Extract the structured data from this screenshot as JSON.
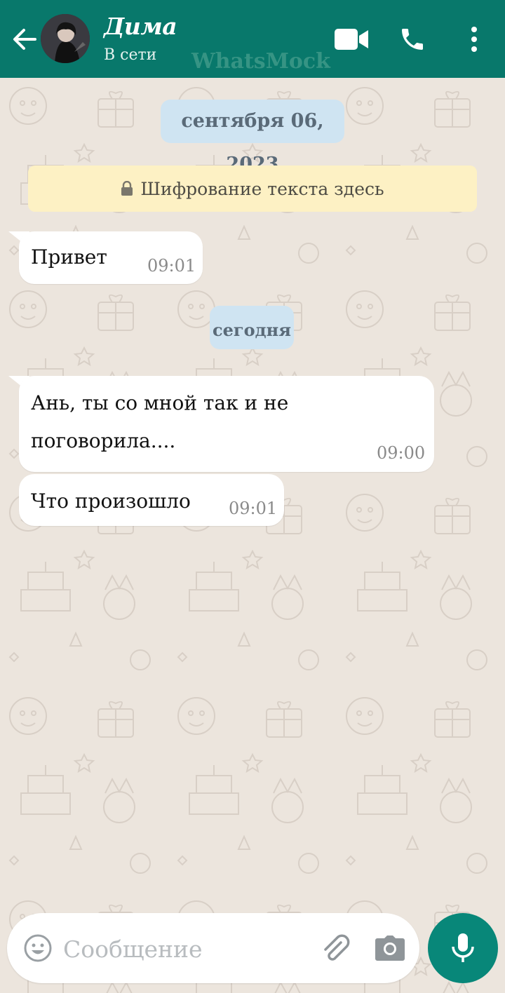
{
  "header": {
    "contact_name": "Дима",
    "status": "В сети",
    "watermark": "WhatsMock",
    "accent_color": "#08786b"
  },
  "chat": {
    "date_chip_1": "сентября 06, 2023",
    "encryption_notice": "Шифрование текста здесь",
    "date_chip_2": "сегодня",
    "messages": [
      {
        "text": "Привет",
        "time": "09:01",
        "direction": "incoming"
      },
      {
        "text_line1": "Ань, ты со мной так и не",
        "text_line2": "поговорила....",
        "time": "09:00",
        "direction": "incoming"
      },
      {
        "text": "Что произошло",
        "time": "09:01",
        "direction": "incoming"
      }
    ]
  },
  "composer": {
    "placeholder": "Сообщение"
  },
  "icons": [
    "back-arrow-icon",
    "video-call-icon",
    "phone-icon",
    "more-vert-icon",
    "lock-icon",
    "emoji-icon",
    "attach-icon",
    "camera-icon",
    "mic-icon"
  ]
}
